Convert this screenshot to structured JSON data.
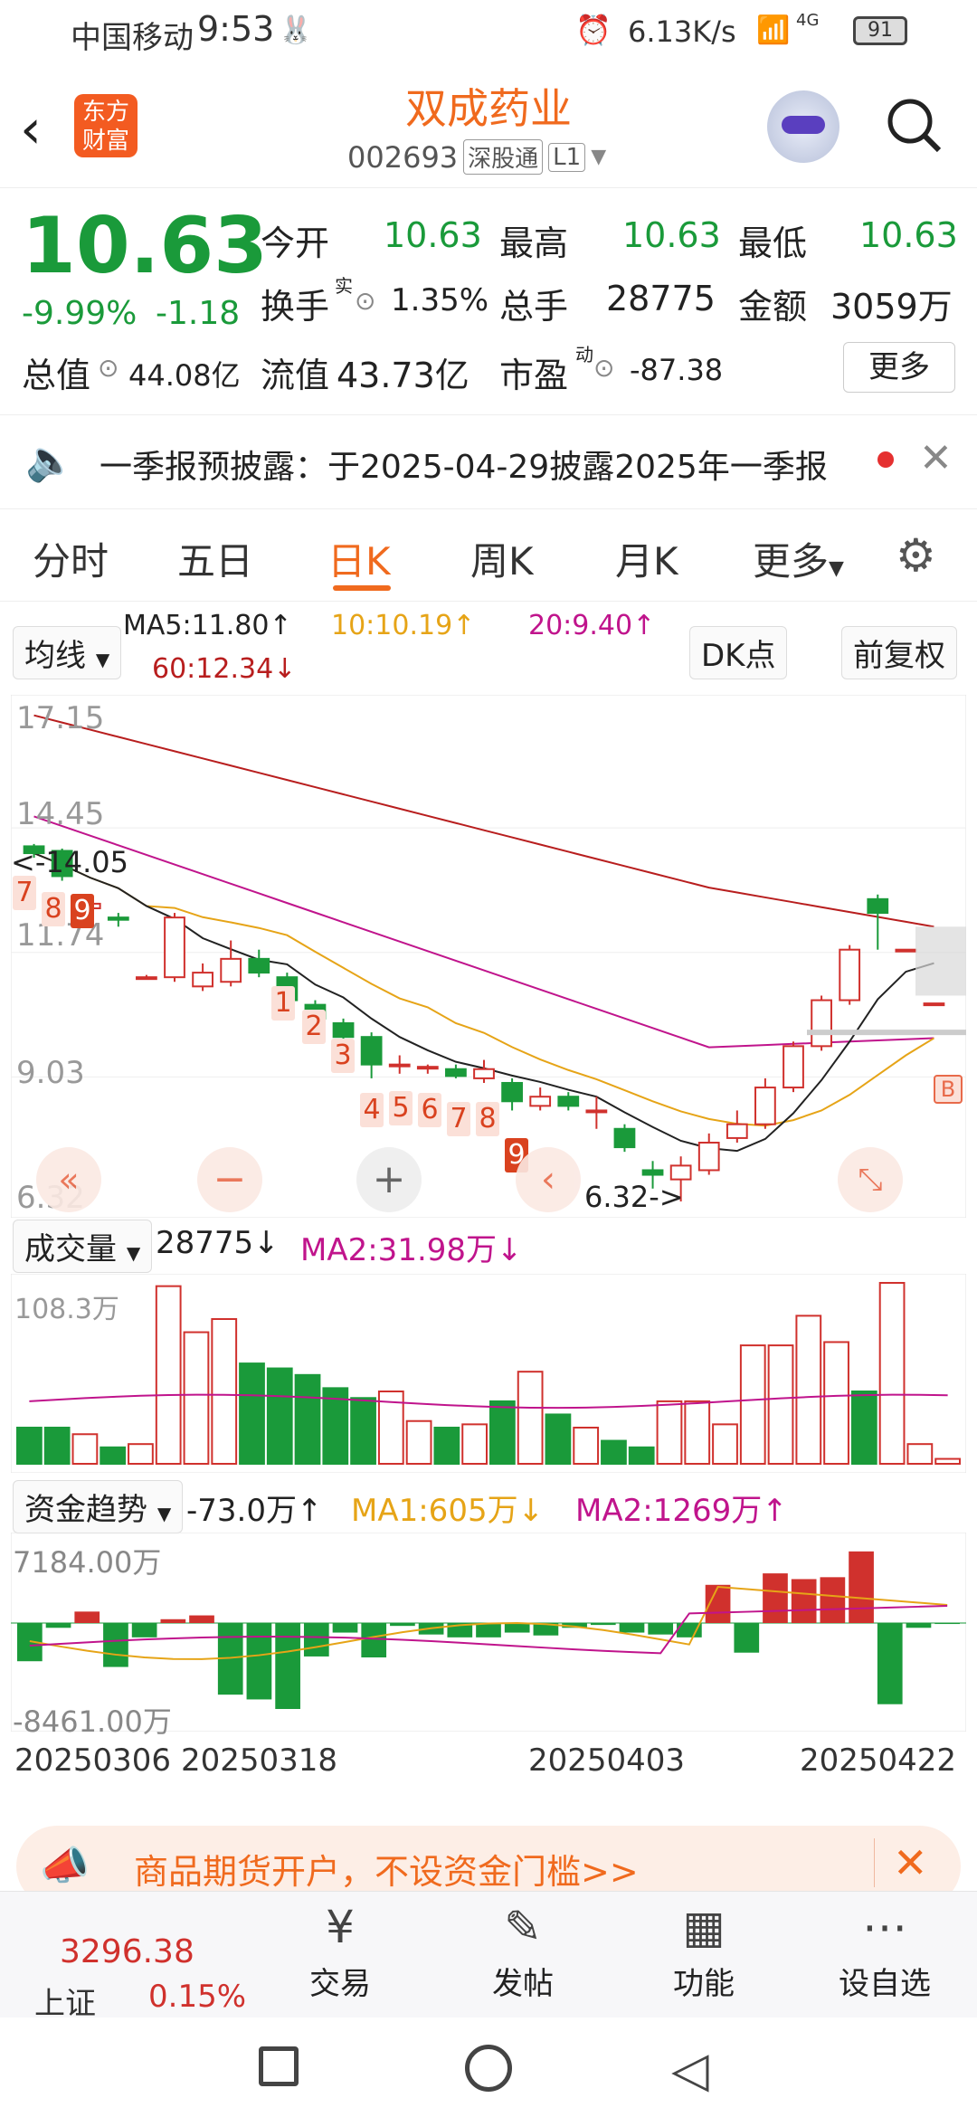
{
  "status": {
    "carrier": "中国移动",
    "time": "9:53",
    "net_speed": "6.13K/s",
    "network": "4G",
    "battery": "91"
  },
  "header": {
    "title": "双成药业",
    "code": "002693",
    "tag1": "深股通",
    "tag2": "L1",
    "logo_top": "东方",
    "logo_bottom": "财富"
  },
  "quote": {
    "price": "10.63",
    "change_pct": "-9.99%",
    "change": "-1.18",
    "open_label": "今开",
    "open": "10.63",
    "high_label": "最高",
    "high": "10.63",
    "low_label": "最低",
    "low": "10.63",
    "turnover_label": "换手",
    "turnover_sup": "实",
    "turnover": "1.35%",
    "volume_label": "总手",
    "volume": "28775",
    "amount_label": "金额",
    "amount": "3059万",
    "mktcap_label": "总值",
    "mktcap": "44.08亿",
    "float_label": "流值",
    "float": "43.73亿",
    "pe_label": "市盈",
    "pe_sup": "动",
    "pe": "-87.38",
    "more": "更多"
  },
  "notice": {
    "text": "一季报预披露：于2025-04-29披露2025年一季报"
  },
  "tabs": [
    "分时",
    "五日",
    "日K",
    "周K",
    "月K",
    "更多"
  ],
  "active_tab": "日K",
  "ma": {
    "selector": "均线",
    "ma5": "MA5:11.80↑",
    "ma10": "10:10.19↑",
    "ma20": "20:9.40↑",
    "ma60": "60:12.34↓",
    "dk": "DK点",
    "fq": "前复权"
  },
  "kline": {
    "axis": [
      "17.15",
      "14.45",
      "11.74",
      "9.03",
      "6.32"
    ],
    "marker_high": "14.05",
    "marker_low": "6.32",
    "badge": "B",
    "seq1": [
      "7",
      "8",
      "9"
    ],
    "seq2": [
      "1",
      "2",
      "3",
      "4",
      "5",
      "6",
      "7",
      "8",
      "9"
    ]
  },
  "volume": {
    "selector": "成交量",
    "value": "28775↓",
    "ma2": "MA2:31.98万↓",
    "axis_top": "108.3万"
  },
  "fund": {
    "selector": "资金趋势",
    "value": "-73.0万↑",
    "ma1": "MA1:605万↓",
    "ma2": "MA2:1269万↑",
    "axis_top": "7184.00万",
    "axis_bottom": "-8461.00万"
  },
  "dates": [
    "20250306",
    "20250318",
    "20250403",
    "20250422"
  ],
  "ad": {
    "text": "商品期货开户，不设资金门槛>>"
  },
  "bottom": {
    "index_value": "3296.38",
    "index_name": "上证",
    "index_pct": "0.15%",
    "trade": "交易",
    "post": "发帖",
    "func": "功能",
    "watch": "设自选"
  },
  "colors": {
    "up": "#d0312d",
    "down": "#1a9a3a",
    "accent": "#f06a1e"
  },
  "chart_data": {
    "type": "candlestick",
    "ylim": [
      6.32,
      17.15
    ],
    "candles": [
      {
        "o": 14.05,
        "c": 13.9,
        "h": 14.1,
        "l": 13.8
      },
      {
        "o": 13.95,
        "c": 13.4,
        "h": 14.0,
        "l": 13.3
      },
      {
        "o": 12.7,
        "c": 12.8,
        "h": 12.9,
        "l": 12.5
      },
      {
        "o": 12.5,
        "c": 12.45,
        "h": 12.6,
        "l": 12.3
      },
      {
        "o": 11.2,
        "c": 11.2,
        "h": 11.25,
        "l": 11.15
      },
      {
        "o": 11.2,
        "c": 12.5,
        "h": 12.6,
        "l": 11.1
      },
      {
        "o": 11.0,
        "c": 11.3,
        "h": 11.5,
        "l": 10.9
      },
      {
        "o": 11.1,
        "c": 11.6,
        "h": 12.0,
        "l": 11.0
      },
      {
        "o": 11.6,
        "c": 11.3,
        "h": 11.8,
        "l": 11.2
      },
      {
        "o": 11.2,
        "c": 10.7,
        "h": 11.3,
        "l": 10.6
      },
      {
        "o": 10.6,
        "c": 10.3,
        "h": 10.7,
        "l": 10.2
      },
      {
        "o": 10.2,
        "c": 9.9,
        "h": 10.3,
        "l": 9.8
      },
      {
        "o": 9.9,
        "c": 9.3,
        "h": 10.0,
        "l": 9.0
      },
      {
        "o": 9.3,
        "c": 9.3,
        "h": 9.5,
        "l": 9.1
      },
      {
        "o": 9.25,
        "c": 9.25,
        "h": 9.3,
        "l": 9.1
      },
      {
        "o": 9.2,
        "c": 9.05,
        "h": 9.3,
        "l": 9.0
      },
      {
        "o": 9.0,
        "c": 9.2,
        "h": 9.4,
        "l": 8.9
      },
      {
        "o": 8.9,
        "c": 8.5,
        "h": 9.0,
        "l": 8.3
      },
      {
        "o": 8.4,
        "c": 8.6,
        "h": 8.8,
        "l": 8.3
      },
      {
        "o": 8.6,
        "c": 8.4,
        "h": 8.7,
        "l": 8.3
      },
      {
        "o": 8.3,
        "c": 8.3,
        "h": 8.6,
        "l": 7.9
      },
      {
        "o": 7.9,
        "c": 7.5,
        "h": 8.0,
        "l": 7.4
      },
      {
        "o": 7.0,
        "c": 6.9,
        "h": 7.2,
        "l": 6.6
      },
      {
        "o": 6.8,
        "c": 7.1,
        "h": 7.3,
        "l": 6.32
      },
      {
        "o": 7.0,
        "c": 7.6,
        "h": 7.8,
        "l": 6.9
      },
      {
        "o": 7.7,
        "c": 8.0,
        "h": 8.3,
        "l": 7.6
      },
      {
        "o": 8.0,
        "c": 8.8,
        "h": 9.0,
        "l": 7.9
      },
      {
        "o": 8.8,
        "c": 9.7,
        "h": 9.8,
        "l": 8.7
      },
      {
        "o": 9.7,
        "c": 10.7,
        "h": 10.8,
        "l": 9.6
      },
      {
        "o": 10.7,
        "c": 11.8,
        "h": 11.9,
        "l": 10.6
      },
      {
        "o": 12.9,
        "c": 12.6,
        "h": 13.0,
        "l": 11.8
      },
      {
        "o": 11.8,
        "c": 11.8,
        "h": 11.8,
        "l": 11.8
      },
      {
        "o": 10.63,
        "c": 10.63,
        "h": 10.63,
        "l": 10.63
      }
    ],
    "volume_max_label": "108.3万",
    "volumes": [
      22,
      22,
      18,
      10,
      12,
      108,
      80,
      88,
      61,
      58,
      54,
      46,
      40,
      44,
      26,
      22,
      24,
      38,
      56,
      30,
      22,
      14,
      10,
      38,
      38,
      24,
      72,
      72,
      90,
      74,
      44,
      110,
      12,
      3
    ],
    "fund_flow": [
      -40,
      -5,
      12,
      -46,
      -15,
      4,
      8,
      -75,
      -80,
      -90,
      -35,
      -10,
      -36,
      -3,
      -12,
      -15,
      -15,
      -10,
      -13,
      -5,
      -2,
      -10,
      -12,
      -15,
      40,
      -31,
      52,
      46,
      48,
      75,
      -85,
      -5,
      -1
    ]
  }
}
